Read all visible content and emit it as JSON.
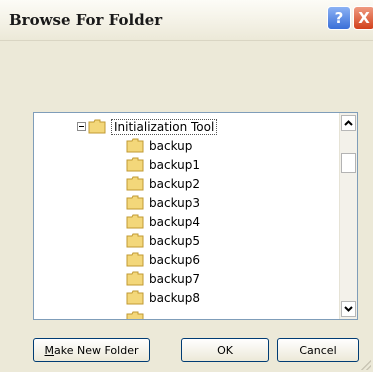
{
  "window": {
    "title": "Browse For Folder",
    "help_label": "?",
    "close_label": "X"
  },
  "tree": {
    "root": {
      "label": "Initialization Tool",
      "expanded": true,
      "selected": true
    },
    "children": [
      {
        "label": "backup"
      },
      {
        "label": "backup1"
      },
      {
        "label": "backup2"
      },
      {
        "label": "backup3"
      },
      {
        "label": "backup4"
      },
      {
        "label": "backup5"
      },
      {
        "label": "backup6"
      },
      {
        "label": "backup7"
      },
      {
        "label": "backup8"
      }
    ]
  },
  "buttons": {
    "make_new_folder_first": "M",
    "make_new_folder_rest": "ake New Folder",
    "ok": "OK",
    "cancel": "Cancel"
  },
  "colors": {
    "dialog_bg": "#ece9d8",
    "tree_border": "#7f9db9",
    "folder": "#f3d77a",
    "close_red": "#d2411c",
    "help_blue": "#3a6fd8"
  },
  "icons": {
    "folder": "folder-icon",
    "collapse": "collapse-minus-icon",
    "scroll_up": "arrow-up-icon",
    "scroll_down": "arrow-down-icon"
  }
}
